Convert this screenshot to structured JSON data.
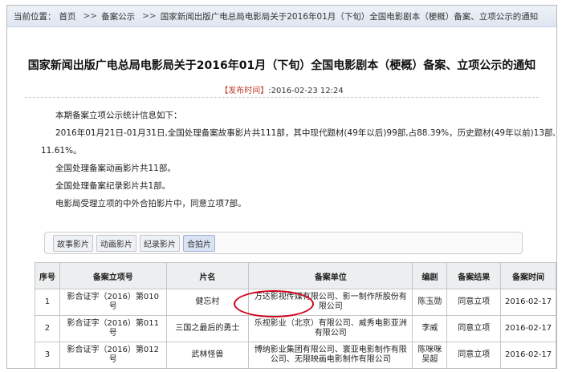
{
  "breadcrumb": {
    "label": "当前位置：",
    "items": [
      "首页",
      "备案公示",
      "国家新闻出版广电总局电影局关于2016年01月（下旬）全国电影剧本（梗概）备案、立项公示的通知"
    ],
    "separator": ">>"
  },
  "article": {
    "title": "国家新闻出版广电总局电影局关于2016年01月（下旬）全国电影剧本（梗概）备案、立项公示的通知",
    "pub_label": "【发布时间】",
    "pub_time": ":2016-02-23 12:24",
    "intro": "本期备案立项公示统计信息如下：",
    "stats_line1": "2016年01月21日-01月31日,全国处理备案故事影片共111部，其中现代题材(49年以后)99部,占88.39%，历史题材(49年以前)13部,占",
    "stats_line2": "11.61%。",
    "animation": "全国处理备案动画影片共11部。",
    "documentary": "全国处理备案纪录影片共1部。",
    "coproduction": "电影局受理立项的中外合拍影片中，同意立项7部。"
  },
  "tabs": [
    "故事影片",
    "动画影片",
    "纪录影片",
    "合拍片"
  ],
  "table": {
    "headers": [
      "序号",
      "备案立项号",
      "片名",
      "备案单位",
      "编剧",
      "备案结果",
      "备案时间"
    ],
    "rows": [
      {
        "no": "1",
        "code": "影合证字（2016）第010号",
        "name": "健忘村",
        "unit": "万达影视传媒有限公司、影一制作所股份有限公司",
        "writer": "陈玉勋",
        "result": "同意立项",
        "date": "2016-02-17"
      },
      {
        "no": "2",
        "code": "影合证字（2016）第011号",
        "name": "三国之最后的勇士",
        "unit": "乐视影业（北京）有限公司、威秀电影亚洲有限公司",
        "writer": "李威",
        "result": "同意立项",
        "date": "2016-02-17"
      },
      {
        "no": "3",
        "code": "影合证字（2016）第012号",
        "name": "武林怪兽",
        "unit": "博纳影业集团有限公司、寰亚电影制作有限公司、无限映画电影制作有限公司",
        "writer": "陈咪咪 吴超",
        "result": "同意立项",
        "date": "2016-02-17"
      }
    ]
  }
}
